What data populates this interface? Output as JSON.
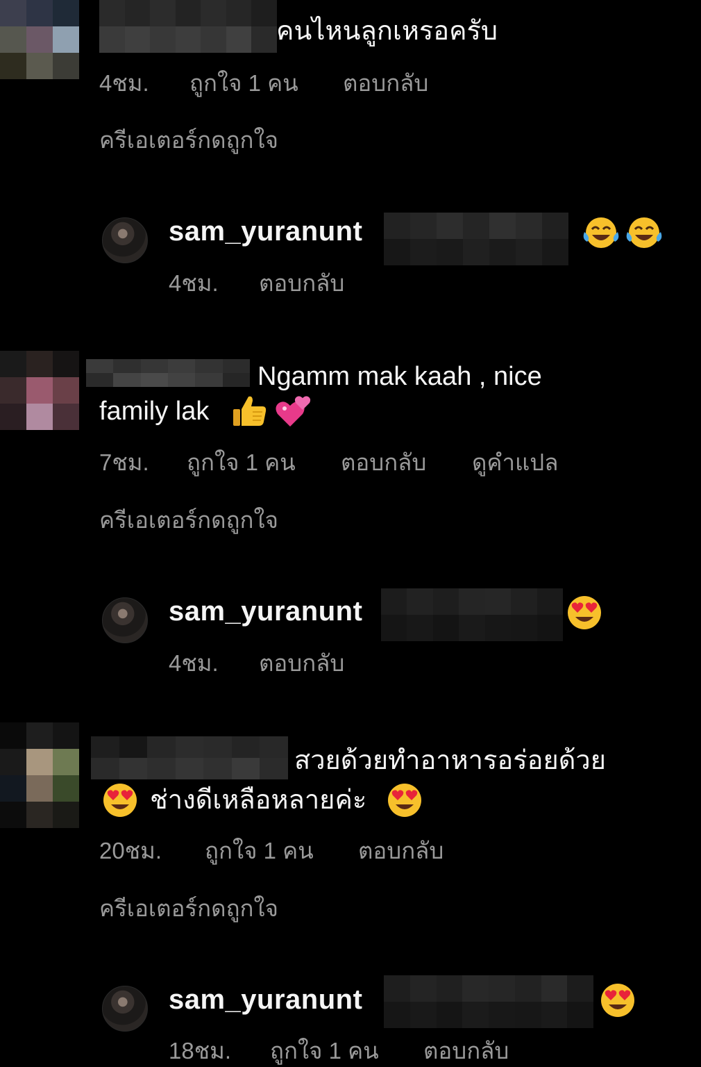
{
  "comments": [
    {
      "text_line1": "คนไหนลูกเหรอครับ",
      "time": "4ชม.",
      "likes": "ถูกใจ 1 คน",
      "reply": "ตอบกลับ",
      "creator_liked": "ครีเอเตอร์กดถูกใจ",
      "creator_reply": {
        "username": "sam_yuranunt",
        "emojis": [
          "face-with-tears-of-joy",
          "face-with-tears-of-joy"
        ],
        "time": "4ชม.",
        "reply": "ตอบกลับ"
      }
    },
    {
      "text_line1": "Ngamm mak kaah , nice",
      "text_line2": "family lak",
      "emojis": [
        "thumbs-up",
        "two-hearts"
      ],
      "time": "7ชม.",
      "likes": "ถูกใจ 1 คน",
      "reply": "ตอบกลับ",
      "translate": "ดูคำแปล",
      "creator_liked": "ครีเอเตอร์กดถูกใจ",
      "creator_reply": {
        "username": "sam_yuranunt",
        "emojis": [
          "heart-eyes"
        ],
        "time": "4ชม.",
        "reply": "ตอบกลับ"
      }
    },
    {
      "text_line1": "สวยด้วยทำอาหารอร่อยด้วย",
      "text_line2": "ช่างดีเหลือหลายค่ะ",
      "emojis": [
        "heart-eyes",
        "heart-eyes"
      ],
      "time": "20ชม.",
      "likes": "ถูกใจ 1 คน",
      "reply": "ตอบกลับ",
      "creator_liked": "ครีเอเตอร์กดถูกใจ",
      "creator_reply": {
        "username": "sam_yuranunt",
        "emojis": [
          "heart-eyes"
        ],
        "time": "18ชม.",
        "likes": "ถูกใจ 1 คน",
        "reply": "ตอบกลับ"
      }
    }
  ],
  "colors": {
    "background": "#000000",
    "text": "#f5f5f5",
    "meta": "#9a9a9a"
  }
}
